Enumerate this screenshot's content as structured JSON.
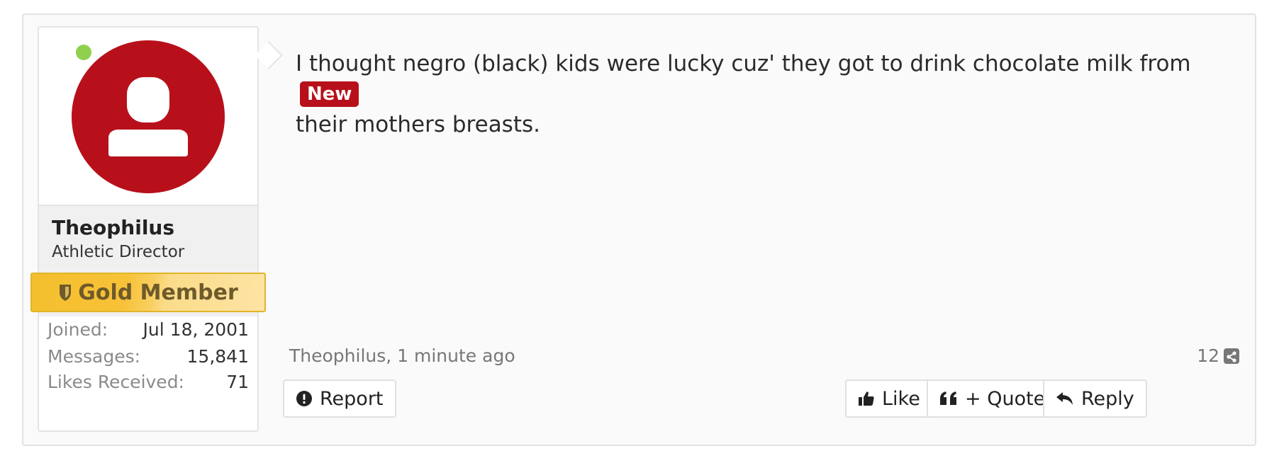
{
  "post": {
    "author": {
      "username": "Theophilus",
      "title": "Athletic Director",
      "banner": "Gold Member",
      "online": true,
      "stats": [
        {
          "label": "Joined:",
          "value": "Jul 18, 2001"
        },
        {
          "label": "Messages:",
          "value": "15,841"
        },
        {
          "label": "Likes Received:",
          "value": "71"
        }
      ]
    },
    "message": {
      "text": "I thought negro (black) kids were lucky cuz' they got to drink chocolate milk from their mothers breasts.",
      "badge": "New"
    },
    "byline": "Theophilus, 1 minute ago",
    "share_count": "12",
    "actions": {
      "report": "Report",
      "like": "Like",
      "quote": "+ Quote",
      "reply": "Reply"
    },
    "colors": {
      "accent_red": "#b8101b",
      "online_green": "#8fd14f",
      "gold": "#f4bf2e"
    }
  }
}
